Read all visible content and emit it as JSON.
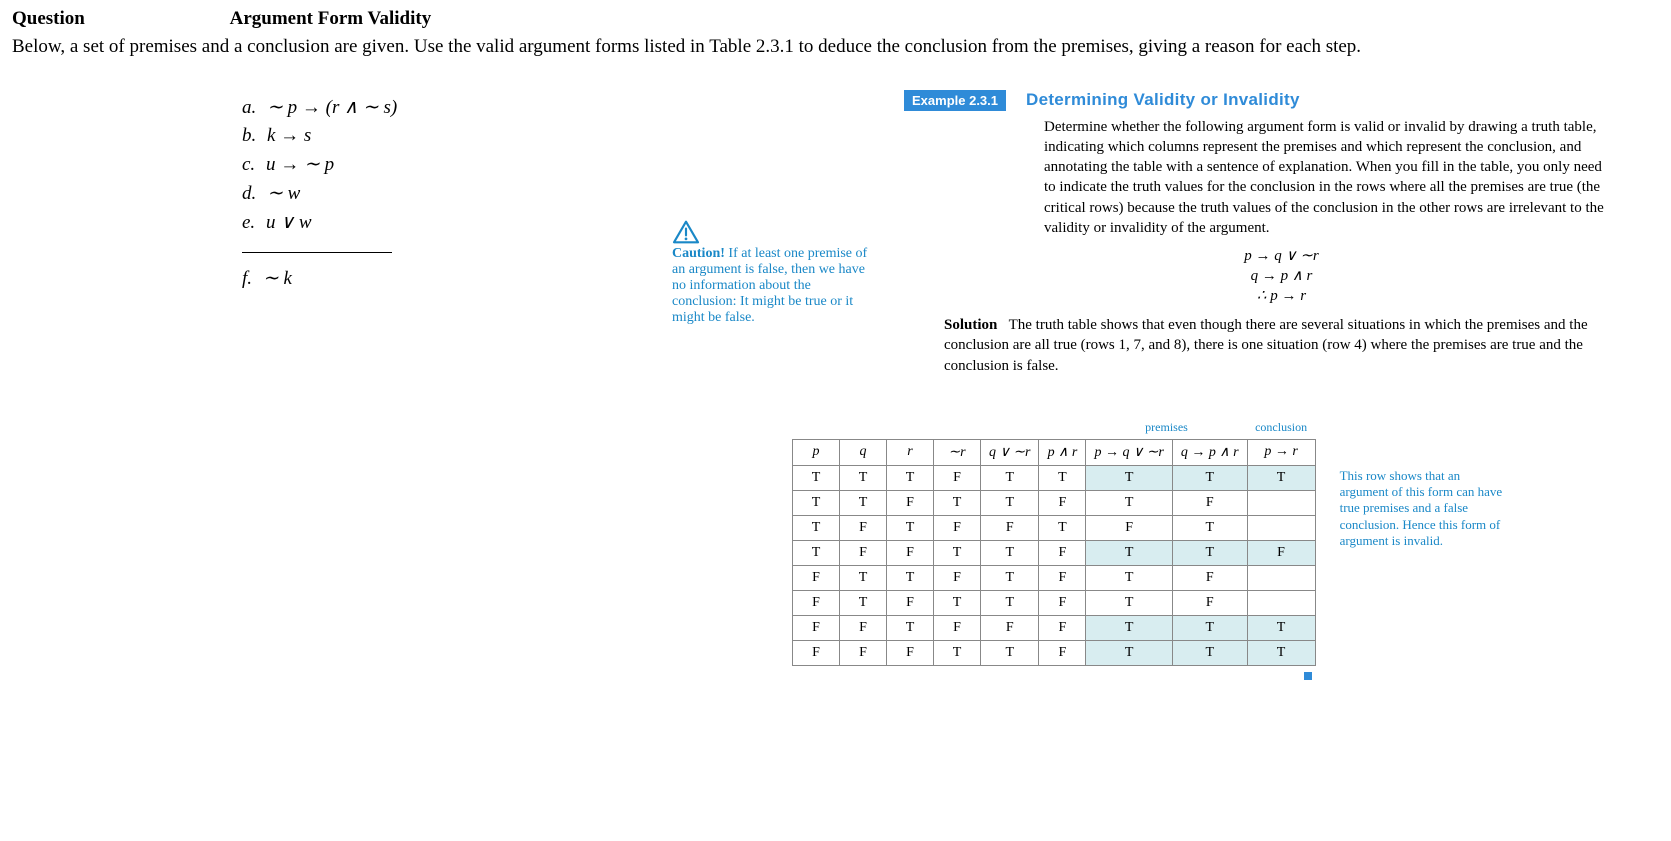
{
  "question": {
    "label": "Question",
    "title": "Argument Form Validity",
    "instructions": "Below, a set of premises and a conclusion are given. Use the valid argument forms listed in Table 2.3.1 to deduce the conclusion from the premises, giving a reason for each step."
  },
  "premises": {
    "a": {
      "label": "a.",
      "expr": "∼ p → (r ∧ ∼ s)"
    },
    "b": {
      "label": "b.",
      "expr": "k → s"
    },
    "c": {
      "label": "c.",
      "expr": "u → ∼ p"
    },
    "d": {
      "label": "d.",
      "expr": "∼ w"
    },
    "e": {
      "label": "e.",
      "expr": "u ∨ w"
    },
    "f": {
      "label": "f.",
      "expr": "∼ k"
    }
  },
  "caution": {
    "label": "Caution!",
    "text": " If at least one premise of an argument is false, then we have no information about the conclusion: It might be true or it might be false."
  },
  "example": {
    "badge": "Example 2.3.1",
    "title": "Determining Validity or Invalidity",
    "intro": "Determine whether the following argument form is valid or invalid by drawing a truth table, indicating which columns represent the premises and which represent the conclusion, and annotating the table with a sentence of explanation. When you fill in the table, you only need to indicate the truth values for the conclusion in the rows where all the premises are true (the critical rows) because the truth values of the conclusion in the other rows are irrelevant to the validity or invalidity of the argument.",
    "form": {
      "l1": "p → q ∨ ∼r",
      "l2": "q → p ∧ r",
      "l3": "∴ p → r"
    },
    "solution_label": "Solution",
    "solution_text": "The truth table shows that even though there are several situations in which the premises and the conclusion are all true (rows 1, 7, and 8), there is one situation (row 4) where the premises are true and the conclusion is false."
  },
  "truth_table": {
    "labels": {
      "premises": "premises",
      "conclusion": "conclusion"
    },
    "headers": [
      "p",
      "q",
      "r",
      "∼r",
      "q ∨ ∼r",
      "p ∧ r",
      "p → q ∨ ∼r",
      "q → p ∧ r",
      "p → r"
    ],
    "rows": [
      {
        "cells": [
          "T",
          "T",
          "T",
          "F",
          "T",
          "T",
          "T",
          "T",
          "T"
        ],
        "hl": [
          6,
          7,
          8
        ]
      },
      {
        "cells": [
          "T",
          "T",
          "F",
          "T",
          "T",
          "F",
          "T",
          "F",
          ""
        ],
        "hl": []
      },
      {
        "cells": [
          "T",
          "F",
          "T",
          "F",
          "F",
          "T",
          "F",
          "T",
          ""
        ],
        "hl": []
      },
      {
        "cells": [
          "T",
          "F",
          "F",
          "T",
          "T",
          "F",
          "T",
          "T",
          "F"
        ],
        "hl": [
          6,
          7,
          8
        ]
      },
      {
        "cells": [
          "F",
          "T",
          "T",
          "F",
          "T",
          "F",
          "T",
          "F",
          ""
        ],
        "hl": []
      },
      {
        "cells": [
          "F",
          "T",
          "F",
          "T",
          "T",
          "F",
          "T",
          "F",
          ""
        ],
        "hl": []
      },
      {
        "cells": [
          "F",
          "F",
          "T",
          "F",
          "F",
          "F",
          "T",
          "T",
          "T"
        ],
        "hl": [
          6,
          7,
          8
        ]
      },
      {
        "cells": [
          "F",
          "F",
          "F",
          "T",
          "T",
          "F",
          "T",
          "T",
          "T"
        ],
        "hl": [
          6,
          7,
          8
        ]
      }
    ]
  },
  "side_note": "This row shows that an argument of this form can have true premises and a false conclusion. Hence this form of argument is invalid."
}
